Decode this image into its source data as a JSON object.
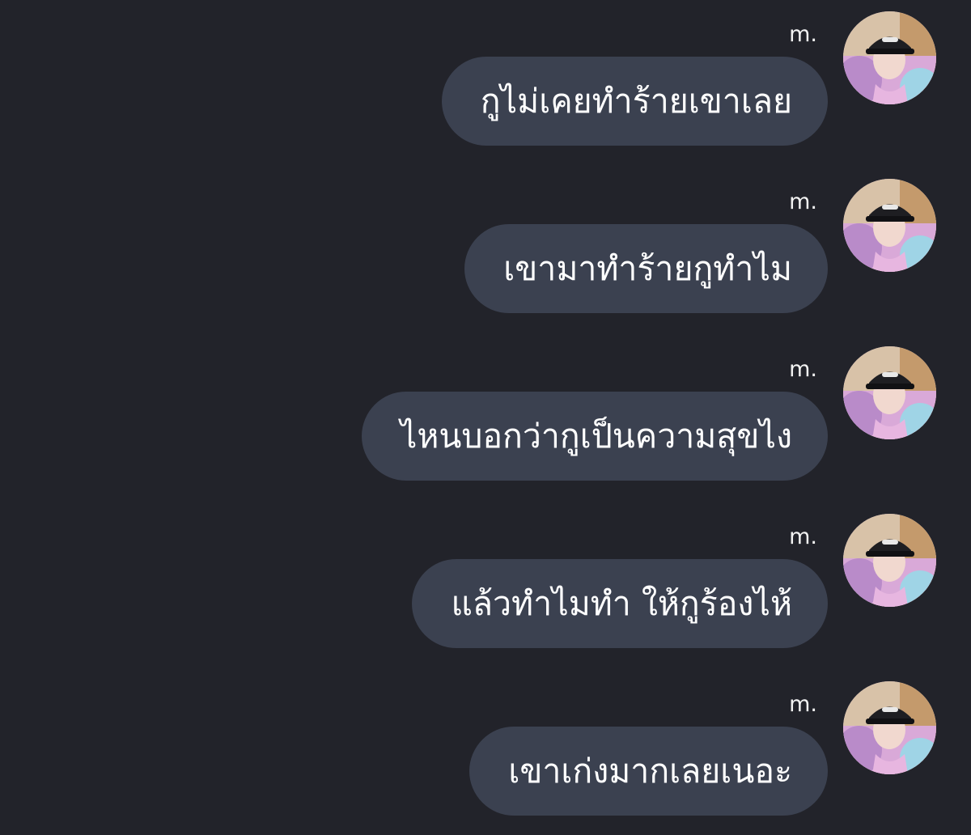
{
  "chat": {
    "messages": [
      {
        "sender": "m.",
        "text": "กูไม่เคยทำร้ายเขาเลย",
        "avatar_icon": "user-avatar-cap-photo"
      },
      {
        "sender": "m.",
        "text": "เขามาทำร้ายกูทำไม",
        "avatar_icon": "user-avatar-cap-photo"
      },
      {
        "sender": "m.",
        "text": "ไหนบอกว่ากูเป็นความสุขไง",
        "avatar_icon": "user-avatar-cap-photo"
      },
      {
        "sender": "m.",
        "text": "แล้วทำไมทำ ให้กูร้องไห้",
        "avatar_icon": "user-avatar-cap-photo"
      },
      {
        "sender": "m.",
        "text": "เขาเก่งมากเลยเนอะ",
        "avatar_icon": "user-avatar-cap-photo"
      }
    ]
  },
  "colors": {
    "background": "#22232a",
    "bubble": "#3b4150",
    "text": "#ffffff"
  }
}
